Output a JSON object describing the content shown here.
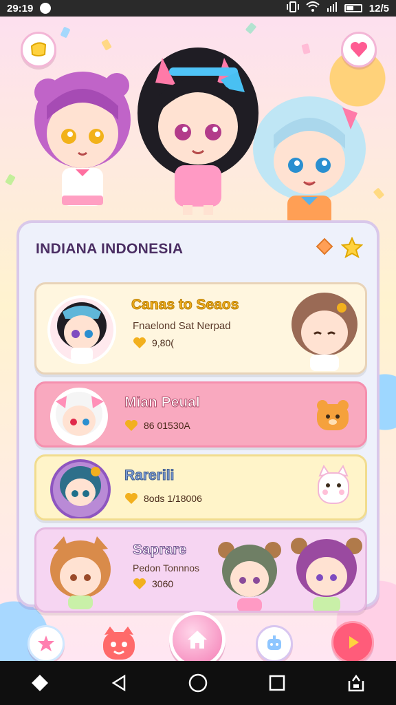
{
  "status_bar": {
    "time": "29:19",
    "battery": "12/5"
  },
  "panel": {
    "title": "INDIANA INDONESIA"
  },
  "cards": [
    {
      "title": "Canas to Seaos",
      "subtitle": "Fnaelond Sat Nerpad",
      "coins": "9,80("
    },
    {
      "title": "Mian Peual",
      "subtitle": "",
      "coins": "86 01530A"
    },
    {
      "title": "Rarerili",
      "subtitle": "",
      "coins": "8ods 1/18006"
    },
    {
      "title": "Saprare",
      "subtitle": "Pedon Tonnnos",
      "coins": "3060"
    }
  ],
  "colors": {
    "card1_bg": "#fff6df",
    "card2_bg": "#f9a9bf",
    "card3_bg": "#fff4c9",
    "card4_bg": "#f6d5f2",
    "accent": "#f47cb4",
    "title_gold": "#f2b01e"
  },
  "icons": {
    "top_left": "ticket-icon",
    "top_right": "heart-icon",
    "nav": [
      "star-heart-icon",
      "cat-face-icon",
      "home-icon",
      "robot-icon",
      "play-icon"
    ],
    "android": [
      "diamond-icon",
      "back-icon",
      "home-circle-icon",
      "recents-icon",
      "share-icon"
    ]
  }
}
